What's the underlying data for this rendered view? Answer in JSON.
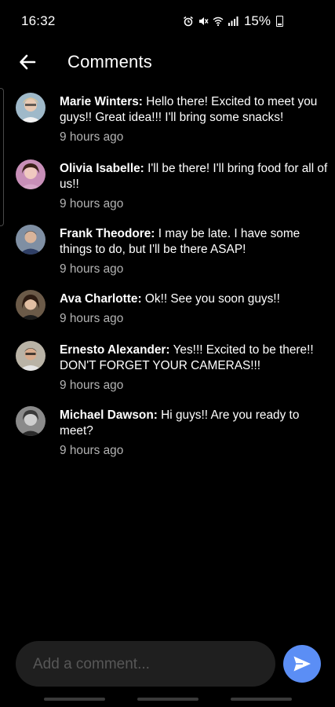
{
  "status_bar": {
    "time": "16:32",
    "battery": "15%",
    "icons": [
      "alarm-icon",
      "mute-icon",
      "wifi-icon",
      "signal-icon",
      "battery-icon"
    ]
  },
  "header": {
    "title": "Comments",
    "back_icon": "back-arrow-icon"
  },
  "comments": [
    {
      "author": "Marie Winters:",
      "text": "Hello there! Excited to meet you guys!! Great idea!!! I'll bring some snacks!",
      "time": "9 hours ago"
    },
    {
      "author": "Olivia Isabelle:",
      "text": "I'll be there! I'll bring food for all of us!!",
      "time": "9 hours ago"
    },
    {
      "author": "Frank Theodore:",
      "text": "I may be late. I have some things to do, but I'll be there ASAP!",
      "time": "9 hours ago"
    },
    {
      "author": "Ava Charlotte:",
      "text": "Ok!! See you soon guys!!",
      "time": "9 hours ago"
    },
    {
      "author": "Ernesto Alexander:",
      "text": "Yes!!! Excited to be there!! DON'T FORGET YOUR CAMERAS!!!",
      "time": "9 hours ago"
    },
    {
      "author": "Michael Dawson:",
      "text": "Hi guys!! Are you ready to meet?",
      "time": "9 hours ago"
    }
  ],
  "composer": {
    "placeholder": "Add a comment...",
    "value": "",
    "send_icon": "send-icon"
  },
  "colors": {
    "background": "#000000",
    "input_background": "#1f1f1f",
    "send_button": "#5b8ef5",
    "timestamp": "#b3b3b3",
    "placeholder": "#575757"
  }
}
